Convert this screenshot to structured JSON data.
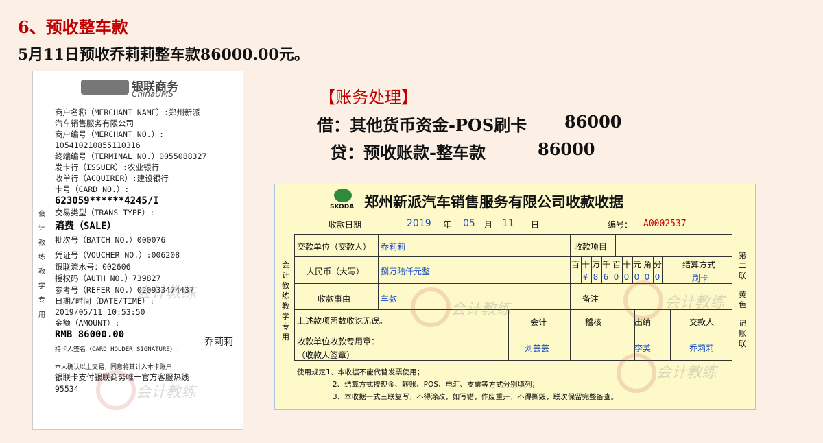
{
  "heading": "6、预收整车款",
  "subheading": "5月11日预收乔莉莉整车款86000.00元。",
  "pos_receipt": {
    "logo_cn": "银联商务",
    "logo_en": "ChinaUMS",
    "lines": [
      "商户名称（MERCHANT NAME）:郑州新派",
      "汽车销售服务有限公司",
      "商户编号（MERCHANT NO.）:",
      "105410210855110316",
      "终端编号（TERMINAL NO.）0055088327",
      "发卡行（ISSUER）:农业银行",
      "收单行（ACQUIRER）:建设银行",
      "卡号（CARD NO.）:",
      "623059******4245/I",
      "交易类型（TRANS TYPE）:",
      "消费（SALE）",
      "批次号（BATCH NO.）000076",
      "凭证号（VOUCHER NO.）:006208",
      "银联流水号：002606",
      "授权码（AUTH NO.）739827",
      "参考号（REFER NO.）020933474437",
      "日期/时间（DATE/TIME）:",
      "2019/05/11 10:53:50",
      "金额（AMOUNT）:",
      "RMB 86000.00",
      "持卡人签名（CARD HOLDER SIGNATURE）:",
      "本人确认以上交易，同意将其计入本卡账户",
      "银联卡支付银联商务唯一官方客服热线",
      "95534"
    ],
    "side_label": [
      "会",
      "计",
      "教",
      "练",
      "教",
      "学",
      "专",
      "用"
    ],
    "signature": "乔莉莉"
  },
  "accounting": {
    "title": "【账务处理】",
    "debit_label": "借：其他货币资金-POS刷卡",
    "debit_amount": "86000",
    "credit_label": "贷：预收账款-整车款",
    "credit_amount": "86000"
  },
  "voucher": {
    "brand": "SKODA",
    "title": "郑州新派汽车销售服务有限公司收款收据",
    "date_label": "收款日期",
    "year": "2019",
    "year_unit": "年",
    "month": "05",
    "month_unit": "月",
    "day": "11",
    "day_unit": "日",
    "no_label": "编号：",
    "no_value": "A0002537",
    "payer_label": "交款单位（交款人）",
    "payer_value": "乔莉莉",
    "item_label": "收款项目",
    "rmb_label": "人民币（大写）",
    "rmb_value": "捌万陆仟元整",
    "digit_headers": [
      "百",
      "十",
      "万",
      "千",
      "百",
      "十",
      "元",
      "角",
      "分"
    ],
    "digits": [
      "",
      "¥",
      "8",
      "6",
      "0",
      "0",
      "0",
      "0",
      "0"
    ],
    "settle_label": "结算方式",
    "settle_value": "刷卡",
    "reason_label": "收款事由",
    "reason_value": "车款",
    "remark_label": "备注",
    "confirm_text": "上述款项照数收讫无误。",
    "stamp_label": "收款单位收款专用章：",
    "signer_label": "（收款人签章）",
    "roles": [
      "会计",
      "稽核",
      "出纳",
      "交款人"
    ],
    "role_values": [
      "刘芸芸",
      "",
      "李美",
      "乔莉莉"
    ],
    "left_side": [
      "会",
      "计",
      "教",
      "练",
      "教",
      "学",
      "专",
      "用"
    ],
    "right_side": [
      "第",
      "二",
      "联",
      "",
      "黄",
      "色",
      "",
      "记",
      "账",
      "联"
    ],
    "rules": [
      "使用规定1、本收据不能代替发票使用；",
      "2、结算方式按现金、转账、POS、电汇、支票等方式分别填列；",
      "3、本收据一式三联复写，不得涂改，如写错，作废重开，不得撕毁，联次保留完整备查。"
    ]
  },
  "watermark_text": "会计教练"
}
